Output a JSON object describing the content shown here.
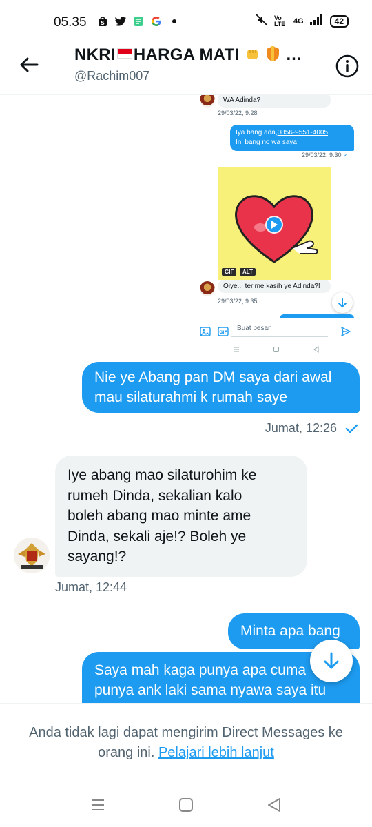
{
  "status_bar": {
    "time": "05.35",
    "battery": "42",
    "network": "4G",
    "volte": "Vo LTE"
  },
  "header": {
    "title_part1": "NKRI",
    "title_part2": "HARGA MATI",
    "title_ellipsis": "…",
    "handle": "@Rachim007"
  },
  "embedded": {
    "msg1_text": "WA Adinda?",
    "msg1_time": "29/03/22, 9:28",
    "msg2_line1_prefix": "Iya bang ada,",
    "msg2_phone": "0856-9551-4005",
    "msg2_line2": "Ini bang no wa saya",
    "msg2_time": "29/03/22, 9:30",
    "gif_tag": "GIF",
    "alt_tag": "ALT",
    "msg3_text": "Oiye... terime kasih ye Adinda?!",
    "msg3_time": "29/03/22, 9:35",
    "composer_placeholder": "Buat pesan"
  },
  "messages": [
    {
      "direction": "out",
      "lines": [
        "Nie ye Abang pan DM saya dari awal",
        "mau silaturahmi k rumah saye"
      ],
      "time": "Jumat, 12:26",
      "seen": true
    },
    {
      "direction": "in",
      "lines": [
        "Iye abang mao silaturohim ke",
        "rumeh Dinda, sekalian kalo",
        "boleh abang mao minte ame",
        "Dinda, sekali aje!? Boleh ye",
        "sayang!?"
      ],
      "time": "Jumat, 12:44"
    },
    {
      "direction": "out",
      "lines": [
        "Minta apa bang"
      ]
    },
    {
      "direction": "out",
      "lines": [
        "Saya mah kaga punya apa cuma",
        "punya ank laki sama nyawa saya itu"
      ]
    }
  ],
  "notice": {
    "text": "Anda tidak lagi dapat mengirim Direct Messages ke orang ini.",
    "link": "Pelajari lebih lanjut"
  },
  "colors": {
    "accent": "#1d9bf0",
    "bubble_in": "#eff3f4",
    "secondary_text": "#536471"
  },
  "icons": [
    "back-arrow-icon",
    "info-icon",
    "scroll-down-icon",
    "check-icon",
    "image-icon",
    "gif-icon",
    "send-icon",
    "play-icon",
    "menu-icon",
    "home-icon",
    "back-nav-icon"
  ]
}
